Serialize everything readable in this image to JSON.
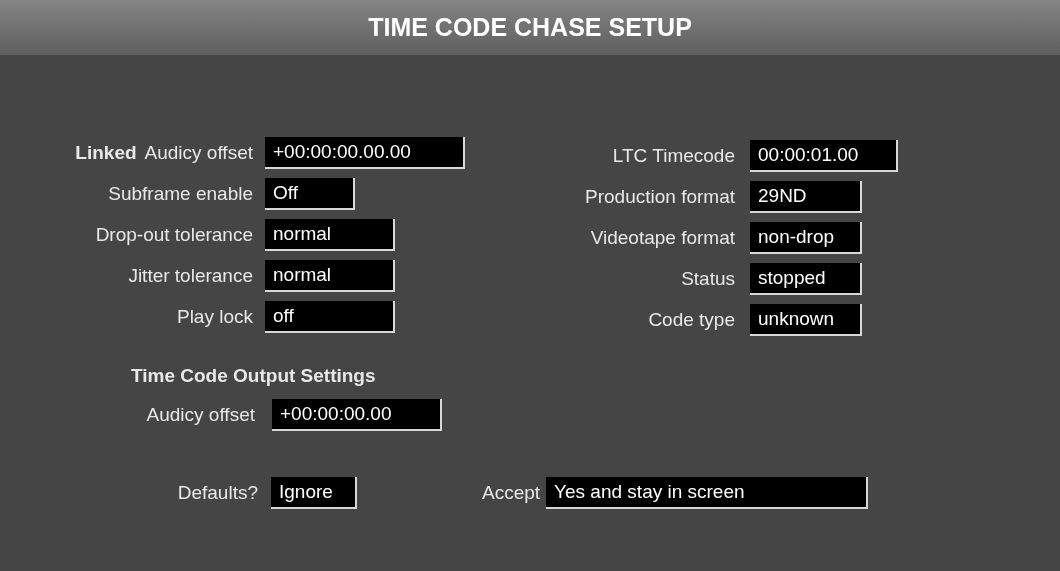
{
  "window": {
    "title": "TIME CODE CHASE SETUP"
  },
  "chase_settings": [
    {
      "prefix": "Linked",
      "label": "Audicy offset",
      "value": "+00:00:00.00.00"
    },
    {
      "label": "Subframe enable",
      "value": "Off"
    },
    {
      "label": "Drop-out tolerance",
      "value": "normal"
    },
    {
      "label": "Jitter tolerance",
      "value": "normal"
    },
    {
      "label": "Play lock",
      "value": "off"
    }
  ],
  "status": [
    {
      "label": "LTC Timecode",
      "value": "00:00:01.00"
    },
    {
      "label": "Production format",
      "value": "29ND"
    },
    {
      "label": "Videotape format",
      "value": "non-drop"
    },
    {
      "label": "Status",
      "value": "stopped"
    },
    {
      "label": "Code type",
      "value": "unknown"
    }
  ],
  "output_settings": {
    "heading": "Time Code Output Settings",
    "fields": [
      {
        "label": "Audicy offset",
        "value": "+00:00:00.00"
      }
    ]
  },
  "footer": [
    {
      "label": "Defaults?",
      "value": "Ignore"
    },
    {
      "label": "Accept",
      "value": "Yes and stay in screen"
    }
  ]
}
